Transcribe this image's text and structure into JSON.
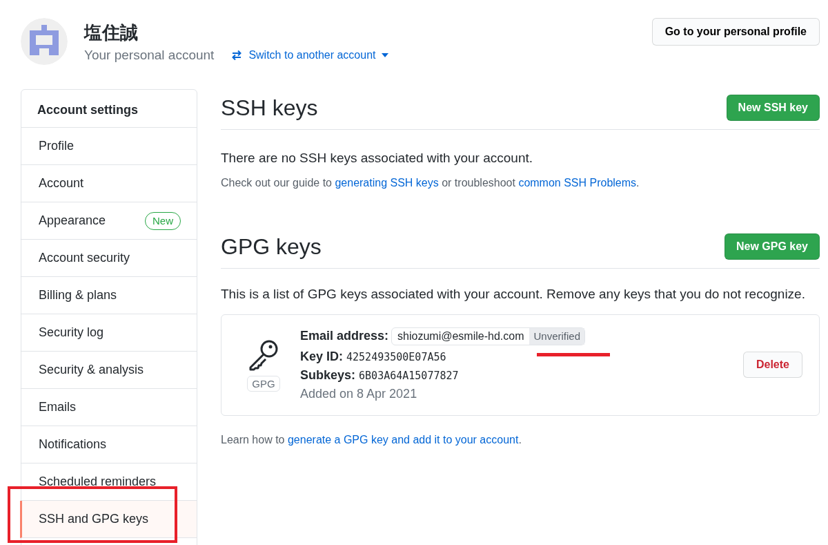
{
  "header": {
    "name": "塩住誠",
    "subtitle": "Your personal account",
    "switch_link": "Switch to another account",
    "profile_button": "Go to your personal profile"
  },
  "sidebar": {
    "title": "Account settings",
    "items": [
      {
        "label": "Profile",
        "selected": false
      },
      {
        "label": "Account",
        "selected": false
      },
      {
        "label": "Appearance",
        "selected": false,
        "badge": "New"
      },
      {
        "label": "Account security",
        "selected": false
      },
      {
        "label": "Billing & plans",
        "selected": false
      },
      {
        "label": "Security log",
        "selected": false
      },
      {
        "label": "Security & analysis",
        "selected": false
      },
      {
        "label": "Emails",
        "selected": false
      },
      {
        "label": "Notifications",
        "selected": false
      },
      {
        "label": "Scheduled reminders",
        "selected": false
      },
      {
        "label": "SSH and GPG keys",
        "selected": true
      }
    ]
  },
  "ssh": {
    "title": "SSH keys",
    "button": "New SSH key",
    "empty": "There are no SSH keys associated with your account.",
    "guide_prefix": "Check out our guide to ",
    "guide_link1": "generating SSH keys",
    "guide_middle": " or troubleshoot ",
    "guide_link2": "common SSH Problems",
    "guide_suffix": "."
  },
  "gpg": {
    "title": "GPG keys",
    "button": "New GPG key",
    "description": "This is a list of GPG keys associated with your account. Remove any keys that you do not recognize.",
    "keys": [
      {
        "type_label": "GPG",
        "email_label": "Email address:",
        "email": "shiozumi@esmile-hd.com",
        "email_status": "Unverified",
        "key_id_label": "Key ID:",
        "key_id": "4252493500E07A56",
        "subkeys_label": "Subkeys:",
        "subkeys": "6B03A64A15077827",
        "added": "Added on 8 Apr 2021",
        "delete": "Delete"
      }
    ],
    "learn_prefix": "Learn how to ",
    "learn_link": "generate a GPG key and add it to your account",
    "learn_suffix": "."
  }
}
